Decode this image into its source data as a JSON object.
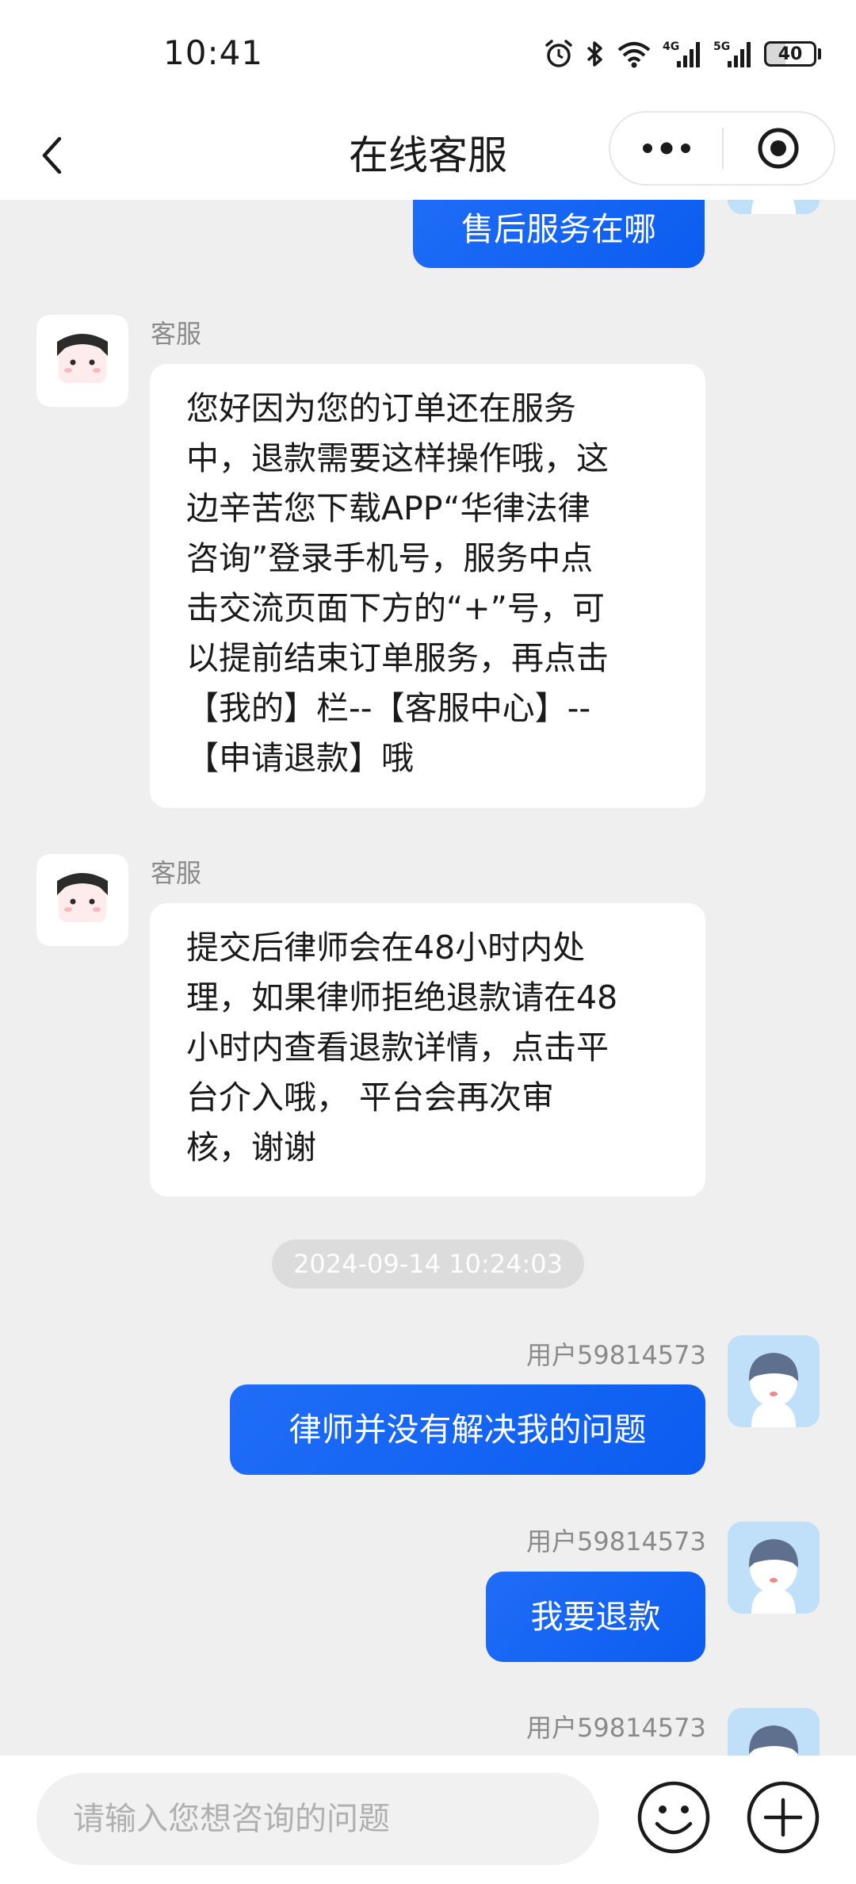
{
  "status_bar": {
    "time": "10:41",
    "battery": "40",
    "network_1": "4G",
    "network_2": "5G",
    "icons": [
      "alarm-icon",
      "bluetooth-icon",
      "wifi-icon",
      "signal-4g-icon",
      "signal-5g-icon",
      "battery-icon"
    ]
  },
  "nav": {
    "title": "在线客服",
    "back_icon": "chevron-left-icon",
    "more_icon": "more-dots-icon",
    "close_icon": "target-close-icon"
  },
  "colors": {
    "accent": "#1466f5",
    "background": "#efefef",
    "bubble_agent": "#ffffff",
    "timestamp_pill": "#dcdcdc"
  },
  "messages": [
    {
      "role": "user",
      "sender": "",
      "text": "售后服务在哪"
    },
    {
      "role": "agent",
      "sender": "客服",
      "text": "您好因为您的订单还在服务\n中，退款需要这样操作哦，这\n边辛苦您下载APP“华律法律\n咨询”登录手机号，服务中点\n击交流页面下方的“+”号，可\n以提前结束订单服务，再点击\n【我的】栏--【客服中心】--\n【申请退款】哦"
    },
    {
      "role": "agent",
      "sender": "客服",
      "text": "提交后律师会在48小时内处\n理，如果律师拒绝退款请在48\n小时内查看退款详情，点击平\n台介入哦，  平台会再次审\n核，谢谢"
    },
    {
      "role": "timestamp",
      "text": "2024-09-14 10:24:03"
    },
    {
      "role": "user",
      "sender": "用户59814573",
      "text": "律师并没有解决我的问题"
    },
    {
      "role": "user",
      "sender": "用户59814573",
      "text": "我要退款"
    },
    {
      "role": "user",
      "sender": "用户59814573",
      "text": ""
    }
  ],
  "input": {
    "placeholder": "请输入您想咨询的问题",
    "emoji_icon": "emoji-icon",
    "plus_icon": "plus-icon"
  }
}
